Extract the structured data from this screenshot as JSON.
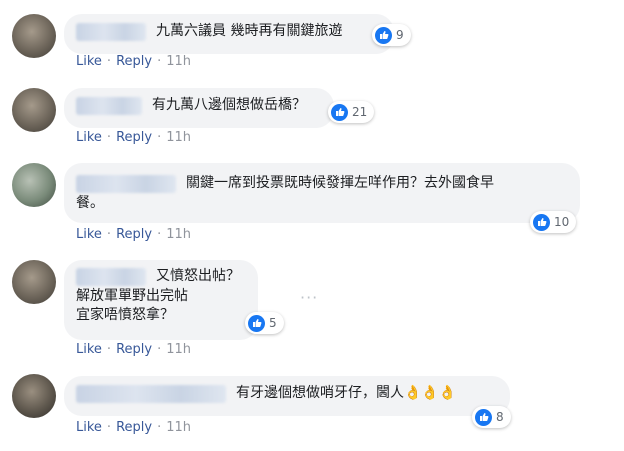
{
  "comments": [
    {
      "text": "九萬六議員 幾時再有關鍵旅遊",
      "reactions": "9",
      "actions": {
        "like": "Like",
        "reply": "Reply",
        "time": "11h"
      }
    },
    {
      "text": "有九萬八邊個想做岳橋？",
      "reactions": "21",
      "actions": {
        "like": "Like",
        "reply": "Reply",
        "time": "11h"
      }
    },
    {
      "text_line1": "關鍵一席到投票既時候發揮左咩作用？去外國食早",
      "text_line2": "餐。",
      "reactions": "10",
      "actions": {
        "like": "Like",
        "reply": "Reply",
        "time": "11h"
      }
    },
    {
      "text_line1": "又憤怒出帖？",
      "text_line2": "解放軍單野出完帖",
      "text_line3": "宜家唔憤怒拿？",
      "reactions": "5",
      "more": "···",
      "actions": {
        "like": "Like",
        "reply": "Reply",
        "time": "11h"
      }
    },
    {
      "text": "有牙邊個想做哨牙仔，閪人👌👌👌",
      "reactions": "8",
      "actions": {
        "like": "Like",
        "reply": "Reply",
        "time": "11h"
      }
    }
  ],
  "colors": {
    "bubble": "#f2f3f5",
    "link": "#385898",
    "meta": "#90949c",
    "like_blue": "#1877f2"
  },
  "icons": {
    "reaction": "thumbs-up-icon",
    "more": "more-options-icon"
  }
}
